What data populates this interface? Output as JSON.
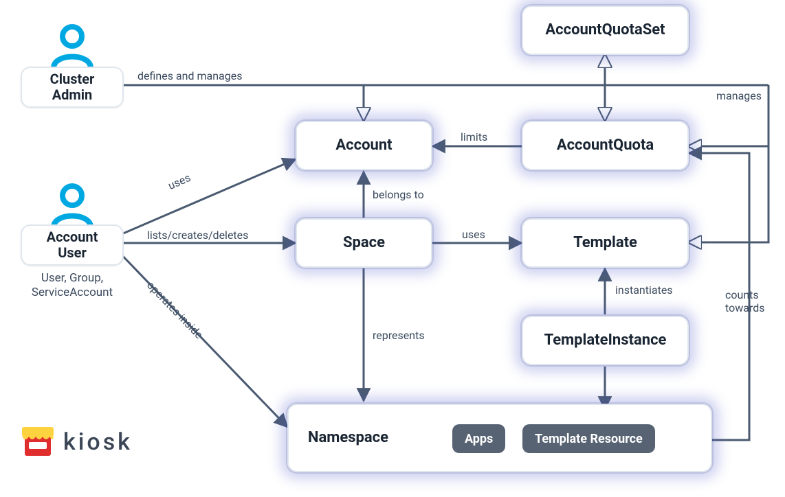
{
  "actors": {
    "cluster_admin": "Cluster\nAdmin",
    "account_user": "Account\nUser",
    "account_user_sub": "User, Group,\nServiceAccount"
  },
  "nodes": {
    "account_quota_set": "AccountQuotaSet",
    "account": "Account",
    "account_quota": "AccountQuota",
    "space": "Space",
    "template": "Template",
    "template_instance": "TemplateInstance",
    "namespace": "Namespace"
  },
  "chips": {
    "apps": "Apps",
    "template_resource": "Template Resource"
  },
  "edges": {
    "defines_manages": "defines and manages",
    "manages": "manages",
    "uses_account": "uses",
    "limits": "limits",
    "belongs_to": "belongs to",
    "lcd": "lists/creates/deletes",
    "uses_template": "uses",
    "instantiates": "instantiates",
    "represents": "represents",
    "operates_inside": "operates inside",
    "counts_towards": "counts\ntowards"
  },
  "brand": {
    "kiosk": "kiosk"
  },
  "chart_data": {
    "type": "diagram",
    "entities": [
      {
        "id": "cluster_admin",
        "kind": "actor",
        "label": "Cluster Admin"
      },
      {
        "id": "account_user",
        "kind": "actor",
        "label": "Account User",
        "subtitle": "User, Group, ServiceAccount"
      },
      {
        "id": "account_quota_set",
        "kind": "resource",
        "label": "AccountQuotaSet"
      },
      {
        "id": "account",
        "kind": "resource",
        "label": "Account"
      },
      {
        "id": "account_quota",
        "kind": "resource",
        "label": "AccountQuota"
      },
      {
        "id": "space",
        "kind": "resource",
        "label": "Space"
      },
      {
        "id": "template",
        "kind": "resource",
        "label": "Template"
      },
      {
        "id": "template_instance",
        "kind": "resource",
        "label": "TemplateInstance"
      },
      {
        "id": "namespace",
        "kind": "resource",
        "label": "Namespace",
        "contains": [
          "Apps",
          "Template Resource"
        ]
      }
    ],
    "relations": [
      {
        "from": "cluster_admin",
        "to": [
          "account",
          "account_quota_set",
          "account_quota",
          "template"
        ],
        "label": "defines and manages"
      },
      {
        "from": "account_quota_set",
        "to": "account_quota",
        "label": "manages",
        "bidirectional": true
      },
      {
        "from": "account_user",
        "to": "account",
        "label": "uses"
      },
      {
        "from": "account_quota",
        "to": "account",
        "label": "limits"
      },
      {
        "from": "space",
        "to": "account",
        "label": "belongs to"
      },
      {
        "from": "account_user",
        "to": "space",
        "label": "lists/creates/deletes"
      },
      {
        "from": "space",
        "to": "template",
        "label": "uses"
      },
      {
        "from": "template_instance",
        "to": "template",
        "label": "instantiates"
      },
      {
        "from": "space",
        "to": "namespace",
        "label": "represents"
      },
      {
        "from": "account_user",
        "to": "namespace",
        "label": "operates inside"
      },
      {
        "from": "namespace",
        "to": "account_quota",
        "label": "counts towards"
      }
    ]
  }
}
